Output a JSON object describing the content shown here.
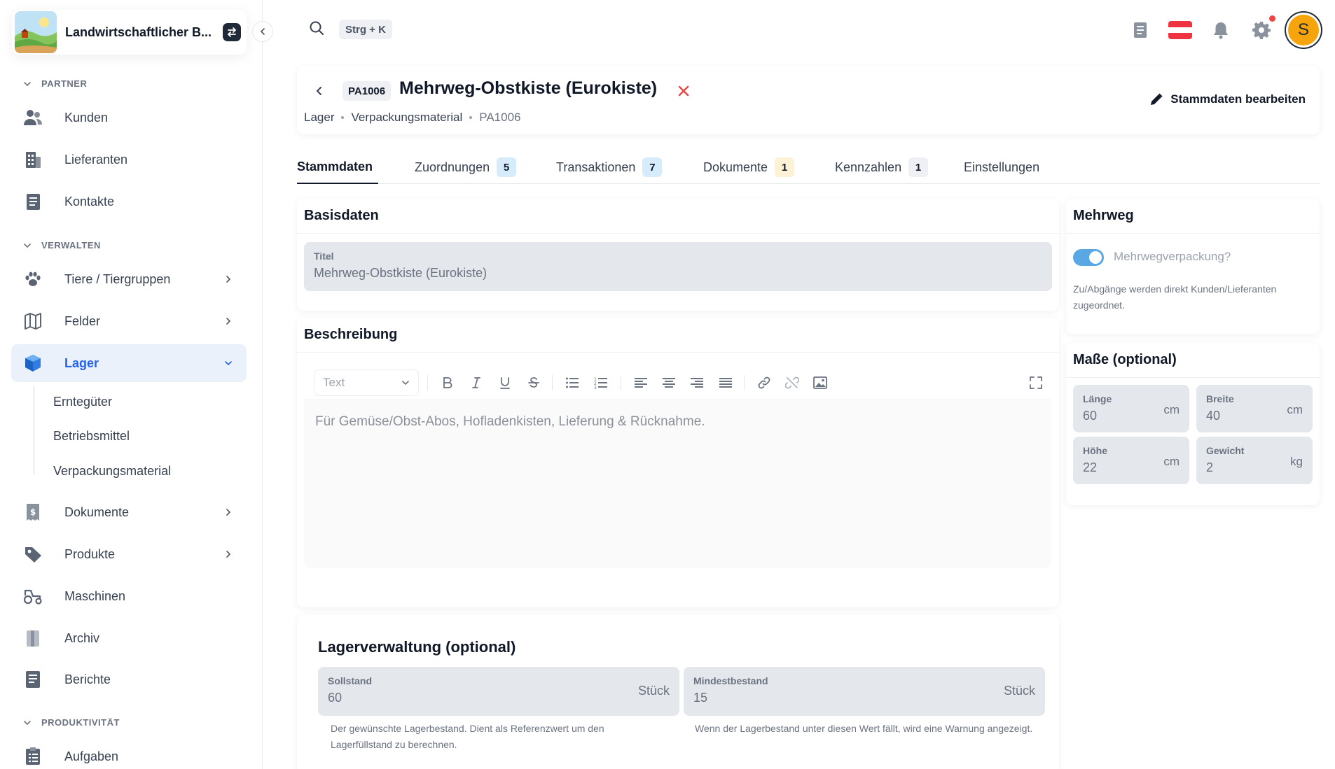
{
  "app": {
    "title": "Landwirtschaftlicher B...",
    "search_shortcut": "Strg + K"
  },
  "sidebar": {
    "sections": {
      "partner": "PARTNER",
      "verwalten": "VERWALTEN",
      "produktivitaet": "PRODUKTIVITÄT"
    },
    "items": {
      "kunden": "Kunden",
      "lieferanten": "Lieferanten",
      "kontakte": "Kontakte",
      "tiere": "Tiere / Tiergruppen",
      "felder": "Felder",
      "lager": "Lager",
      "dokumente": "Dokumente",
      "produkte": "Produkte",
      "maschinen": "Maschinen",
      "archiv": "Archiv",
      "berichte": "Berichte",
      "aufgaben": "Aufgaben"
    },
    "lager_sub": {
      "erntegueter": "Erntegüter",
      "betriebsmittel": "Betriebsmittel",
      "verpackungsmaterial": "Verpackungsmaterial"
    }
  },
  "header": {
    "id": "PA1006",
    "title": "Mehrweg-Obstkiste (Eurokiste)",
    "breadcrumb": [
      "Lager",
      "Verpackungsmaterial",
      "PA1006"
    ],
    "edit_label": "Stammdaten bearbeiten"
  },
  "tabs": [
    {
      "label": "Stammdaten",
      "badge": ""
    },
    {
      "label": "Zuordnungen",
      "badge": "5"
    },
    {
      "label": "Transaktionen",
      "badge": "7"
    },
    {
      "label": "Dokumente",
      "badge": "1"
    },
    {
      "label": "Kennzahlen",
      "badge": "1"
    },
    {
      "label": "Einstellungen",
      "badge": ""
    }
  ],
  "basisdaten": {
    "heading": "Basisdaten",
    "titel_label": "Titel",
    "titel_value": "Mehrweg-Obstkiste (Eurokiste)"
  },
  "beschreibung": {
    "heading": "Beschreibung",
    "format_select": "Text",
    "content": "Für Gemüse/Obst-Abos, Hofladenkisten, Lieferung & Rücknahme."
  },
  "lagerverwaltung": {
    "heading": "Lagerverwaltung (optional)",
    "sollstand_label": "Sollstand",
    "sollstand_value": "60",
    "sollstand_unit": "Stück",
    "sollstand_hint": "Der gewünschte Lagerbestand. Dient als Referenzwert um den Lagerfüllstand zu berechnen.",
    "mindest_label": "Mindestbestand",
    "mindest_value": "15",
    "mindest_unit": "Stück",
    "mindest_hint": "Wenn der Lagerbestand unter diesen Wert fällt, wird eine Warnung angezeigt."
  },
  "mehrweg": {
    "heading": "Mehrweg",
    "toggle_label": "Mehrwegverpackung?",
    "toggle_on": true,
    "hint": "Zu/Abgänge werden direkt Kunden/Lieferanten zugeordnet."
  },
  "masse": {
    "heading": "Maße (optional)",
    "laenge_label": "Länge",
    "laenge_value": "60",
    "laenge_unit": "cm",
    "breite_label": "Breite",
    "breite_value": "40",
    "breite_unit": "cm",
    "hoehe_label": "Höhe",
    "hoehe_value": "22",
    "hoehe_unit": "cm",
    "gewicht_label": "Gewicht",
    "gewicht_value": "2",
    "gewicht_unit": "kg"
  },
  "user": {
    "initial": "S"
  },
  "colors": {
    "accent": "#2563eb",
    "avatar": "#f5a50b",
    "close": "#ef4444",
    "toggle": "#5aa7e6",
    "badge_blue": "#d6ecfb",
    "badge_yellow": "#fdf1d6",
    "badge_gray": "#eef0f3"
  }
}
